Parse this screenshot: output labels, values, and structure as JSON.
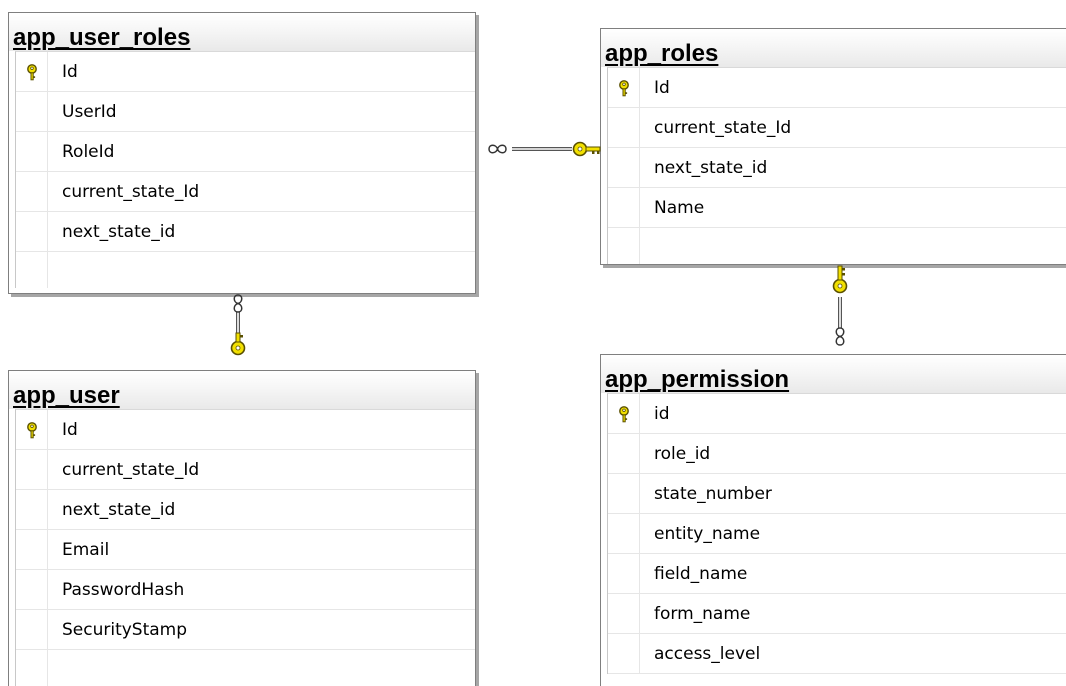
{
  "diagram": {
    "tables": [
      {
        "id": "app_user_roles",
        "title": "app_user_roles",
        "columns": [
          {
            "name": "Id",
            "primary_key": true
          },
          {
            "name": "UserId",
            "primary_key": false
          },
          {
            "name": "RoleId",
            "primary_key": false
          },
          {
            "name": "current_state_Id",
            "primary_key": false
          },
          {
            "name": "next_state_id",
            "primary_key": false
          }
        ]
      },
      {
        "id": "app_roles",
        "title": "app_roles",
        "columns": [
          {
            "name": "Id",
            "primary_key": true
          },
          {
            "name": "current_state_Id",
            "primary_key": false
          },
          {
            "name": "next_state_id",
            "primary_key": false
          },
          {
            "name": "Name",
            "primary_key": false
          }
        ]
      },
      {
        "id": "app_user",
        "title": "app_user",
        "columns": [
          {
            "name": "Id",
            "primary_key": true
          },
          {
            "name": "current_state_Id",
            "primary_key": false
          },
          {
            "name": "next_state_id",
            "primary_key": false
          },
          {
            "name": "Email",
            "primary_key": false
          },
          {
            "name": "PasswordHash",
            "primary_key": false
          },
          {
            "name": "SecurityStamp",
            "primary_key": false
          }
        ]
      },
      {
        "id": "app_permission",
        "title": "app_permission",
        "columns": [
          {
            "name": "id",
            "primary_key": true
          },
          {
            "name": "role_id",
            "primary_key": false
          },
          {
            "name": "state_number",
            "primary_key": false
          },
          {
            "name": "entity_name",
            "primary_key": false
          },
          {
            "name": "field_name",
            "primary_key": false
          },
          {
            "name": "form_name",
            "primary_key": false
          },
          {
            "name": "access_level",
            "primary_key": false
          }
        ]
      }
    ],
    "relationships": [
      {
        "from": "app_user_roles",
        "to": "app_roles",
        "from_end": "many",
        "to_end": "one"
      },
      {
        "from": "app_user_roles",
        "to": "app_user",
        "from_end": "many",
        "to_end": "one"
      },
      {
        "from": "app_permission",
        "to": "app_roles",
        "from_end": "many",
        "to_end": "one"
      }
    ],
    "colors": {
      "key_icon": "#f2e000",
      "key_outline": "#5a5000",
      "connector_line": "#555555",
      "table_border": "#7f7f7f",
      "table_shadow": "#a6a6a6"
    },
    "icons": {
      "primary_key": "key-icon",
      "many_end": "infinity-icon",
      "one_end": "key-icon"
    }
  }
}
